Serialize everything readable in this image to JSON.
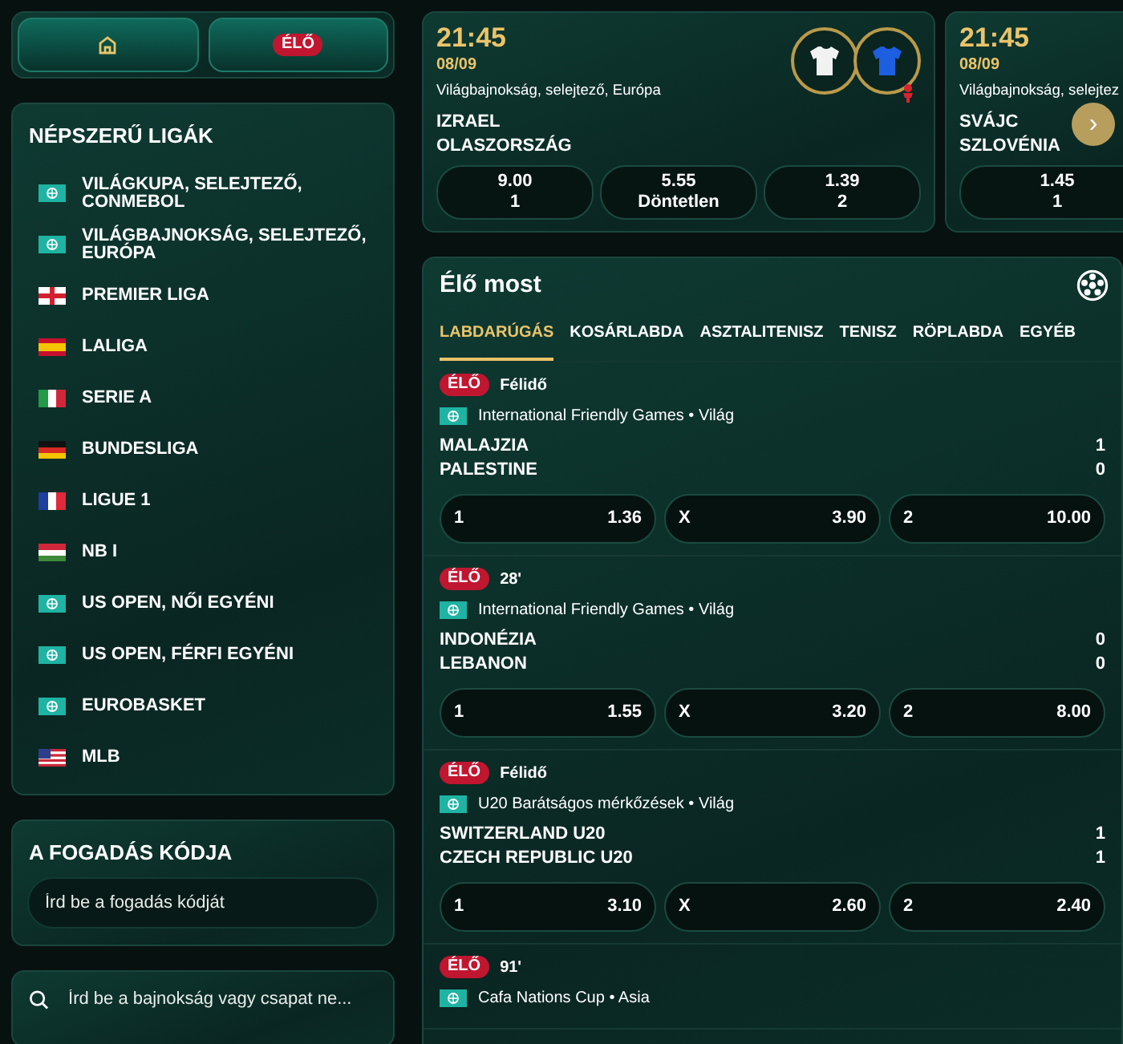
{
  "nav": {
    "home_selected": false,
    "live_label": "ÉLŐ"
  },
  "popular_leagues": {
    "title": "NÉPSZERŰ LIGÁK",
    "items": [
      {
        "name": "VILÁGKUPA, SELEJTEZŐ, CONMEBOL",
        "kind": "world"
      },
      {
        "name": "VILÁGBAJNOKSÁG, SELEJTEZŐ, EURÓPA",
        "kind": "world"
      },
      {
        "name": "PREMIER LIGA",
        "kind": "england"
      },
      {
        "name": "LALIGA",
        "kind": "spain"
      },
      {
        "name": "SERIE A",
        "kind": "italy"
      },
      {
        "name": "BUNDESLIGA",
        "kind": "germany"
      },
      {
        "name": "LIGUE 1",
        "kind": "france"
      },
      {
        "name": "NB I",
        "kind": "hungary"
      },
      {
        "name": "US OPEN, NŐI EGYÉNI",
        "kind": "world"
      },
      {
        "name": "US OPEN, FÉRFI EGYÉNI",
        "kind": "world"
      },
      {
        "name": "EUROBASKET",
        "kind": "world"
      },
      {
        "name": "MLB",
        "kind": "usa"
      }
    ]
  },
  "bet_code": {
    "title": "A FOGADÁS KÓDJA",
    "placeholder": "Írd be a fogadás kódját"
  },
  "search": {
    "placeholder": "Írd be a bajnokság vagy csapat ne..."
  },
  "featured_matches": [
    {
      "time": "21:45",
      "date": "08/09",
      "league": "Világbajnokság, selejtező, Európa",
      "teams": [
        {
          "name": "IZRAEL",
          "color": "#f2f2f2"
        },
        {
          "name": "OLASZORSZÁG",
          "color": "#1d5fe0"
        }
      ],
      "odds": [
        {
          "value": "9.00",
          "label": "1"
        },
        {
          "value": "5.55",
          "label": "Döntetlen"
        },
        {
          "value": "1.39",
          "label": "2"
        }
      ]
    },
    {
      "time": "21:45",
      "date": "08/09",
      "league": "Világbajnokság, selejtez",
      "teams": [
        {
          "name": "SVÁJC"
        },
        {
          "name": "SZLOVÉNIA"
        }
      ],
      "odds": [
        {
          "value": "1.45",
          "label": "1"
        }
      ]
    }
  ],
  "next_arrow": "›",
  "live": {
    "title": "Élő most",
    "tabs": [
      {
        "label": "LABDARÚGÁS",
        "selected": true
      },
      {
        "label": "KOSÁRLABDA",
        "selected": false
      },
      {
        "label": "ASZTALITENISZ",
        "selected": false
      },
      {
        "label": "TENISZ",
        "selected": false
      },
      {
        "label": "RÖPLABDA",
        "selected": false
      },
      {
        "label": "EGYÉB",
        "selected": false
      }
    ],
    "matches": [
      {
        "badge": "ÉLŐ",
        "status": "Félidő",
        "league": "International Friendly Games • Világ",
        "teams": [
          {
            "name": "MALAJZIA",
            "score": "1"
          },
          {
            "name": "PALESTINE",
            "score": "0"
          }
        ],
        "odds": [
          {
            "label": "1",
            "value": "1.36"
          },
          {
            "label": "X",
            "value": "3.90"
          },
          {
            "label": "2",
            "value": "10.00"
          }
        ]
      },
      {
        "badge": "ÉLŐ",
        "status": "28'",
        "league": "International Friendly Games • Világ",
        "teams": [
          {
            "name": "INDONÉZIA",
            "score": "0"
          },
          {
            "name": "LEBANON",
            "score": "0"
          }
        ],
        "odds": [
          {
            "label": "1",
            "value": "1.55"
          },
          {
            "label": "X",
            "value": "3.20"
          },
          {
            "label": "2",
            "value": "8.00"
          }
        ]
      },
      {
        "badge": "ÉLŐ",
        "status": "Félidő",
        "league": "U20 Barátságos mérkőzések • Világ",
        "teams": [
          {
            "name": "SWITZERLAND U20",
            "score": "1"
          },
          {
            "name": "CZECH REPUBLIC U20",
            "score": "1"
          }
        ],
        "odds": [
          {
            "label": "1",
            "value": "3.10"
          },
          {
            "label": "X",
            "value": "2.60"
          },
          {
            "label": "2",
            "value": "2.40"
          }
        ]
      },
      {
        "badge": "ÉLŐ",
        "status": "91'",
        "league": "Cafa Nations Cup • Asia"
      }
    ]
  }
}
